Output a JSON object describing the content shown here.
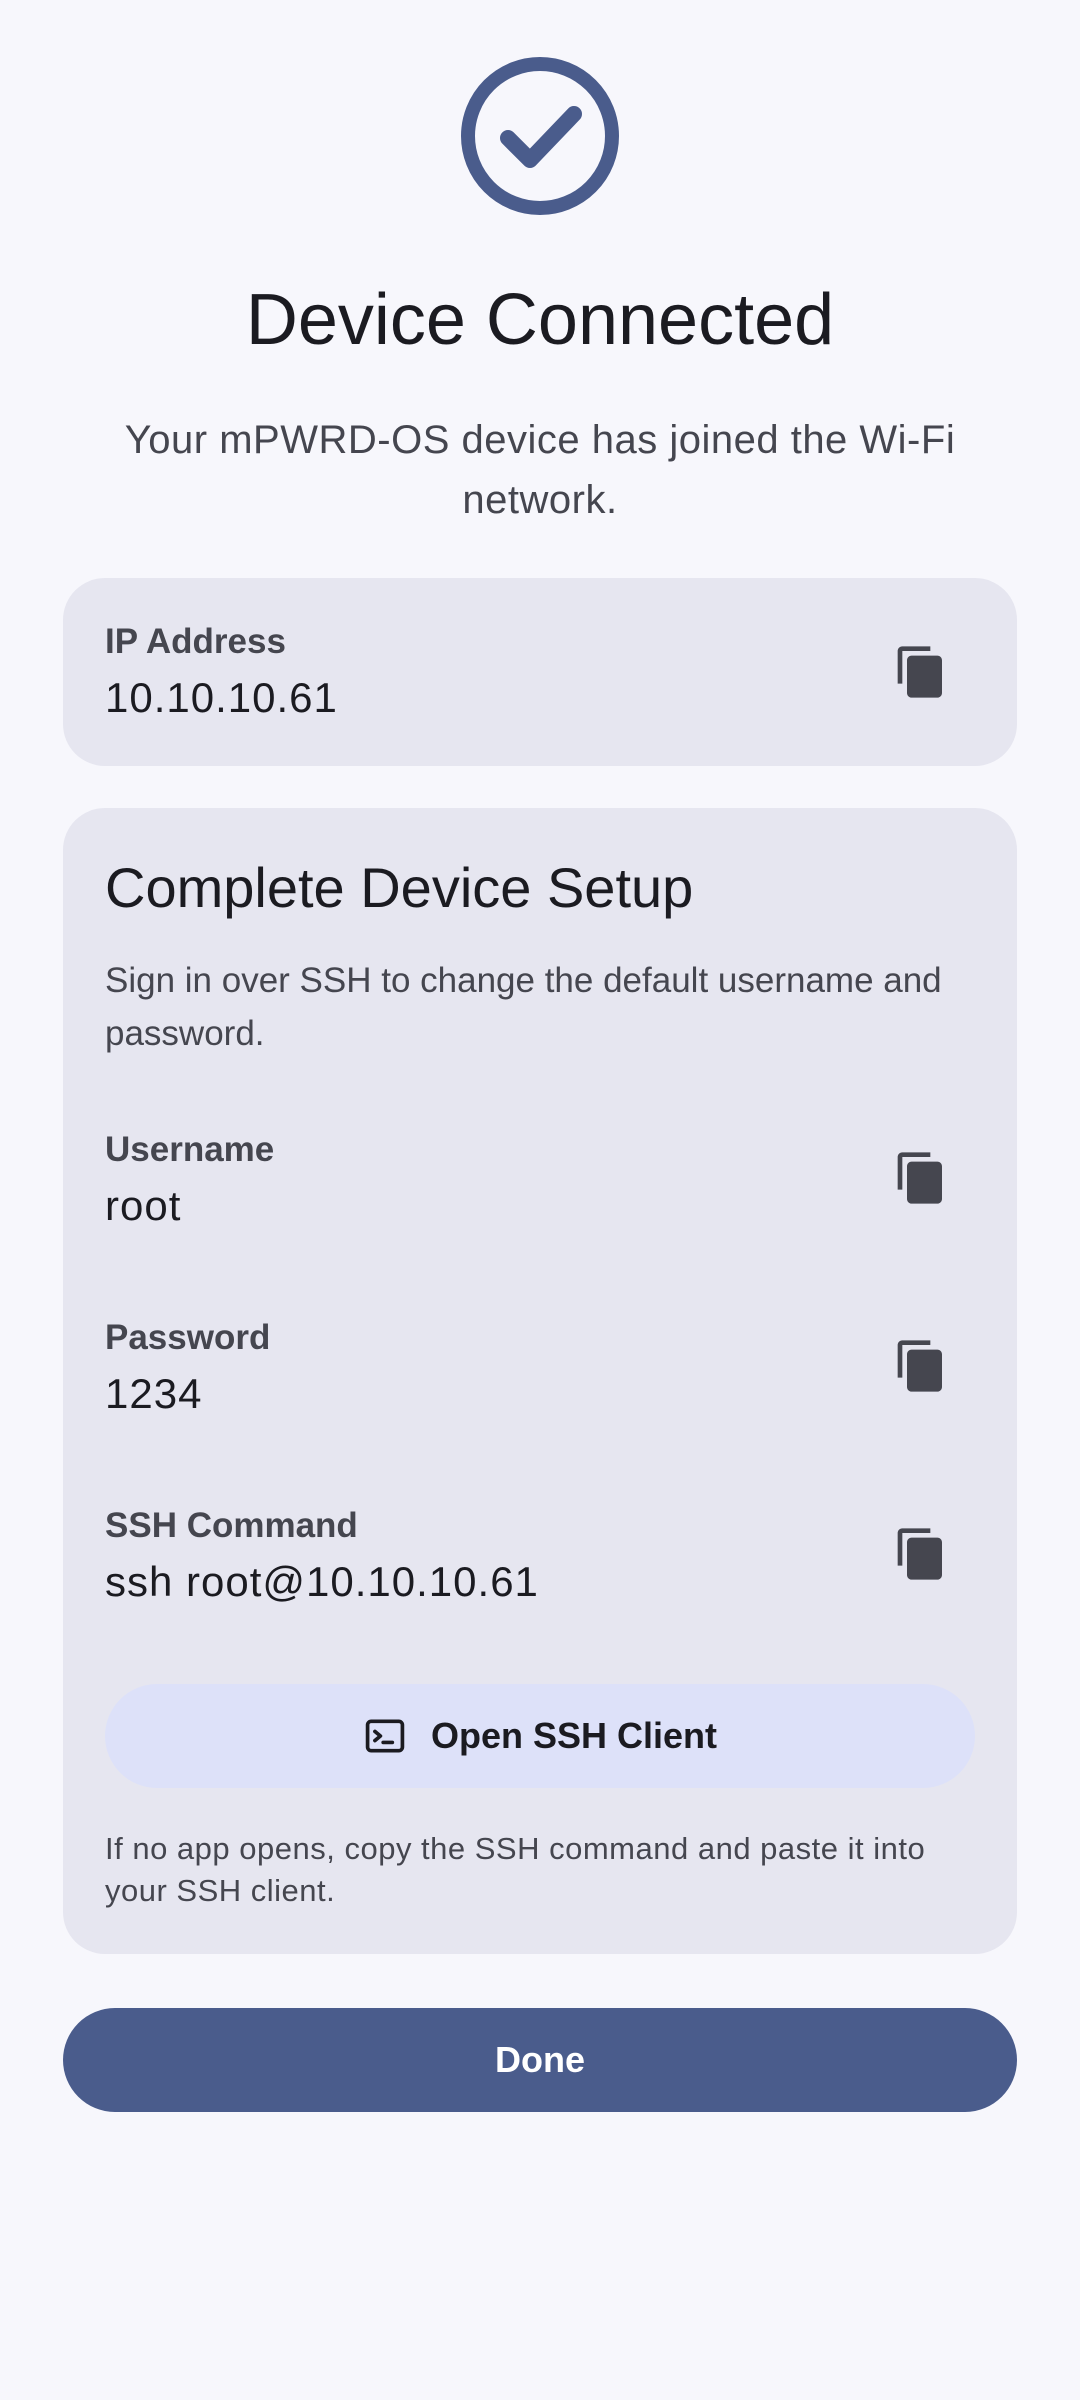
{
  "header": {
    "icon": "check-circle-icon",
    "title": "Device Connected",
    "subtitle": "Your mPWRD-OS device has joined the Wi-Fi network."
  },
  "ip_card": {
    "label": "IP Address",
    "value": "10.10.10.61",
    "copy_icon": "copy-icon"
  },
  "setup_card": {
    "title": "Complete Device Setup",
    "description": "Sign in over SSH to change the default username and password.",
    "fields": [
      {
        "label": "Username",
        "value": "root",
        "copy_icon": "copy-icon"
      },
      {
        "label": "Password",
        "value": "1234",
        "copy_icon": "copy-icon"
      },
      {
        "label": "SSH Command",
        "value": "ssh root@10.10.10.61",
        "copy_icon": "copy-icon"
      }
    ],
    "ssh_button": {
      "icon": "terminal-icon",
      "label": "Open SSH Client"
    },
    "hint": "If no app opens, copy the SSH command and paste it into your SSH client."
  },
  "done_button": {
    "label": "Done"
  },
  "colors": {
    "background": "#f7f7fc",
    "card": "#e6e6f0",
    "accent": "#4a5c8c",
    "ssh_button_bg": "#dde1f9",
    "icon": "#45464f"
  }
}
